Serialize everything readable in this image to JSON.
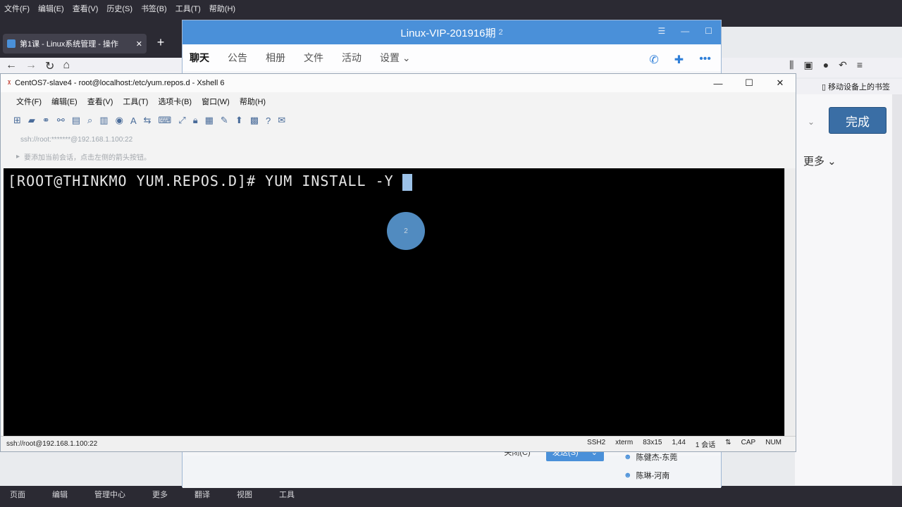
{
  "firefox": {
    "menubar": [
      "文件(F)",
      "编辑(E)",
      "查看(V)",
      "历史(S)",
      "书签(B)",
      "工具(T)",
      "帮助(H)"
    ],
    "tab_title": "第1课 - Linux系统管理 - 操作",
    "new_tab": "+",
    "bookmark_label": "移动设备上的书签",
    "done_button": "完成",
    "more_link": "更多 ⌄",
    "bottom_menu": [
      "页面",
      "编辑",
      "管理中心",
      "更多",
      "翻译",
      "视图",
      "工具"
    ]
  },
  "qq": {
    "title": "Linux-VIP-201916期",
    "title_suffix": "2",
    "tabs": [
      "聊天",
      "公告",
      "相册",
      "文件",
      "活动",
      "设置 ⌄"
    ],
    "close_button": "关闭(C)",
    "send_button": "发送(S)",
    "send_arrow": "⌄",
    "members": [
      "陈健杰-东莞",
      "陈琳-河南"
    ]
  },
  "xshell": {
    "title": "CentOS7-slave4 - root@localhost:/etc/yum.repos.d - Xshell 6",
    "menu": [
      "文件(F)",
      "编辑(E)",
      "查看(V)",
      "工具(T)",
      "选项卡(B)",
      "窗口(W)",
      "帮助(H)"
    ],
    "address": "ssh://root:*******@192.168.1.100:22",
    "hint": "要添加当前会话，点击左侧的箭头按钮。",
    "terminal_line": "[ROOT@THINKMO YUM.REPOS.D]# YUM INSTALL -Y ",
    "click_indicator": "2",
    "status": {
      "connection": "ssh://root@192.168.1.100:22",
      "protocol": "SSH2",
      "term": "xterm",
      "size": "83x15",
      "position": "1,44",
      "sessions": "1 会话",
      "caps": "CAP",
      "num": "NUM"
    }
  }
}
